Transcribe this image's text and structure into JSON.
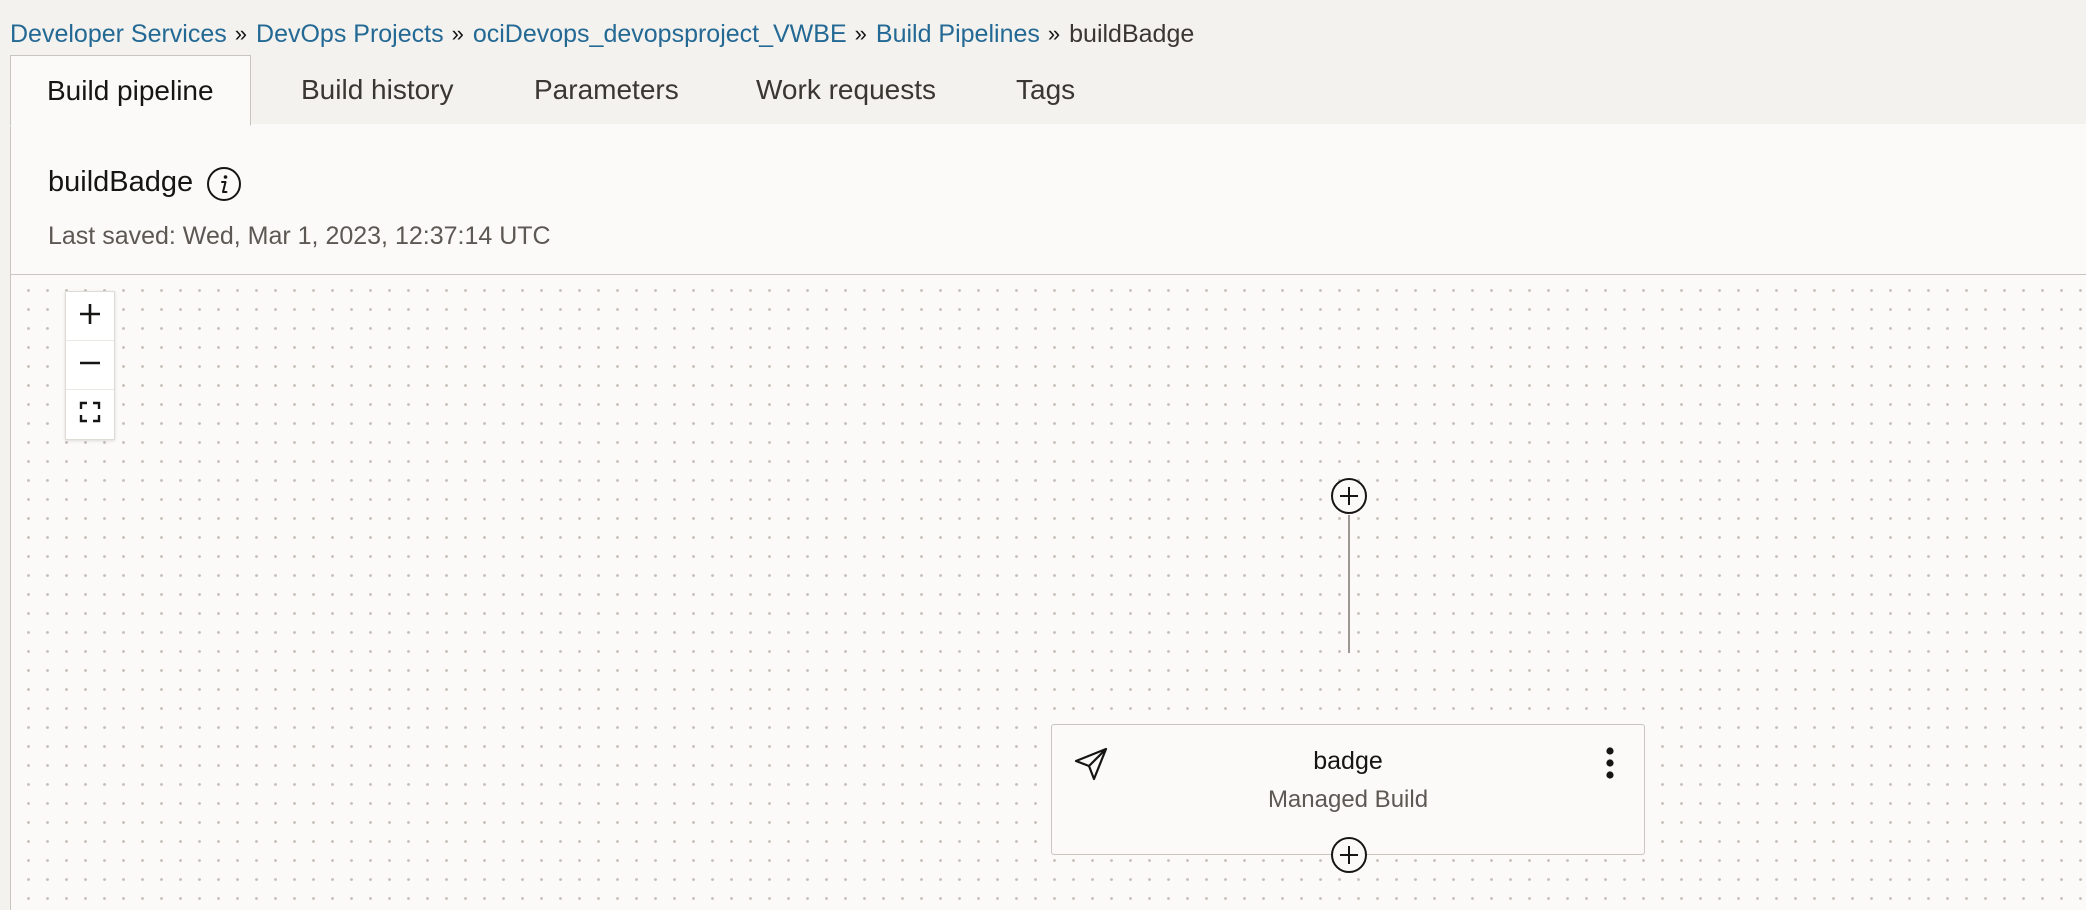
{
  "breadcrumb": {
    "items": [
      {
        "label": "Developer Services"
      },
      {
        "label": "DevOps Projects"
      },
      {
        "label": "ociDevops_devopsproject_VWBE"
      },
      {
        "label": "Build Pipelines"
      }
    ],
    "current": "buildBadge",
    "separator": "»"
  },
  "tabs": [
    {
      "label": "Build pipeline",
      "active": true
    },
    {
      "label": "Build history",
      "active": false
    },
    {
      "label": "Parameters",
      "active": false
    },
    {
      "label": "Work requests",
      "active": false
    },
    {
      "label": "Tags",
      "active": false
    }
  ],
  "header": {
    "title": "buildBadge",
    "info_icon": "info-icon",
    "last_saved": "Last saved: Wed, Mar 1, 2023, 12:37:14 UTC"
  },
  "canvas": {
    "zoom_controls": [
      {
        "name": "zoom-in-icon"
      },
      {
        "name": "zoom-out-icon"
      },
      {
        "name": "fit-to-screen-icon"
      }
    ],
    "stage": {
      "name": "badge",
      "type": "Managed Build",
      "icon": "send-icon",
      "menu_icon": "kebab-menu-icon"
    }
  },
  "colors": {
    "link": "#236994",
    "text": "#161513",
    "muted_text": "#5c5853",
    "border": "#c9c5bf",
    "panel_bg": "#fbfaf8"
  }
}
